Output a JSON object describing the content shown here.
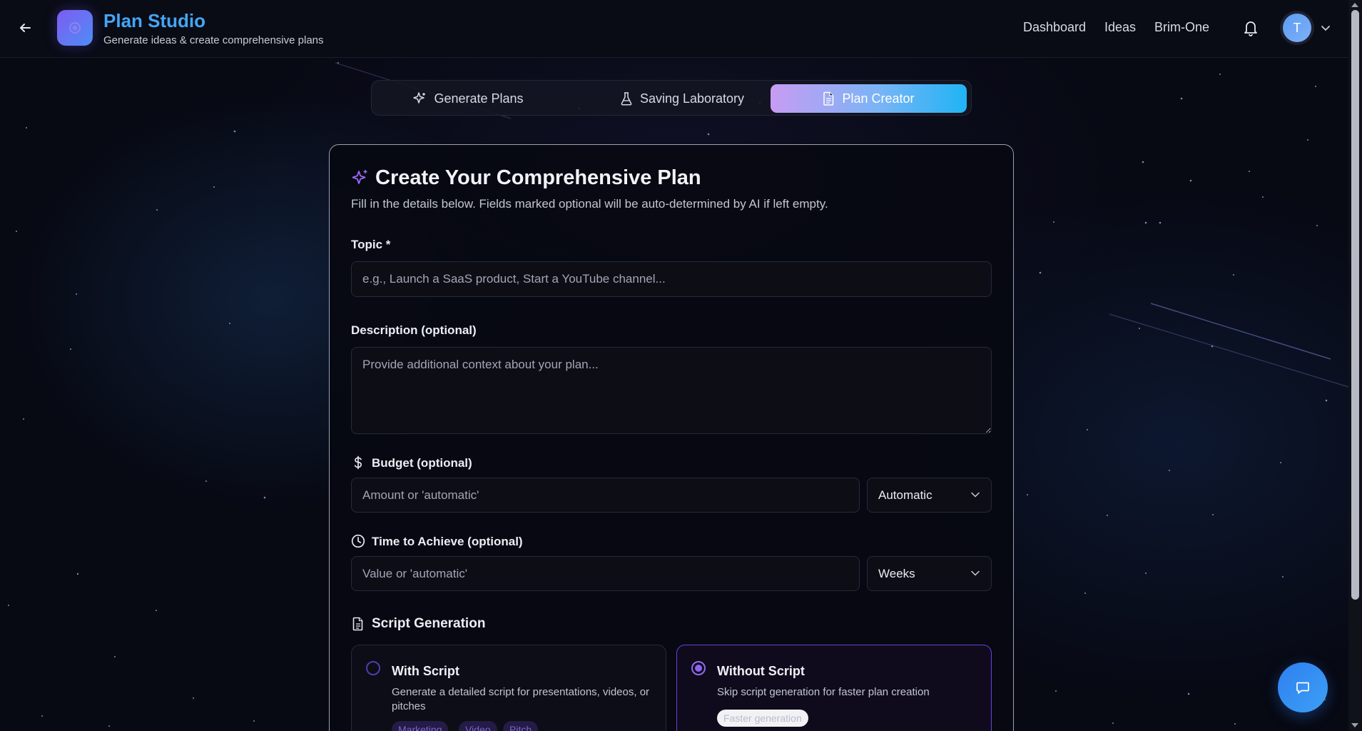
{
  "header": {
    "brand_title": "Plan Studio",
    "brand_subtitle": "Generate ideas & create comprehensive plans",
    "nav": [
      "Dashboard",
      "Ideas",
      "Brim-One"
    ],
    "avatar_initial": "T"
  },
  "tabs": [
    {
      "label": "Generate Plans",
      "icon": "sparkles-icon",
      "active": false
    },
    {
      "label": "Saving Laboratory",
      "icon": "flask-icon",
      "active": false
    },
    {
      "label": "Plan Creator",
      "icon": "document-icon",
      "active": true
    }
  ],
  "form": {
    "title": "Create Your Comprehensive Plan",
    "subtitle": "Fill in the details below. Fields marked optional will be auto-determined by AI if left empty.",
    "topic": {
      "label": "Topic *",
      "placeholder": "e.g., Launch a SaaS product, Start a YouTube channel..."
    },
    "description": {
      "label": "Description (optional)",
      "placeholder": "Provide additional context about your plan..."
    },
    "budget": {
      "label": "Budget (optional)",
      "placeholder": "Amount or 'automatic'",
      "select_value": "Automatic"
    },
    "time": {
      "label": "Time to Achieve (optional)",
      "placeholder": "Value or 'automatic'",
      "select_value": "Weeks"
    },
    "script_section": {
      "title": "Script Generation",
      "options": [
        {
          "title": "With Script",
          "description": "Generate a detailed script for presentations, videos, or pitches",
          "tags": [
            "Marketing",
            "Video",
            "Pitch"
          ],
          "selected": false
        },
        {
          "title": "Without Script",
          "description": "Skip script generation for faster plan creation",
          "tags": [
            "Faster generation"
          ],
          "selected": true
        }
      ]
    }
  },
  "colors": {
    "accent": "#43a6f5",
    "purple": "#8b63f0",
    "background": "#070913"
  }
}
